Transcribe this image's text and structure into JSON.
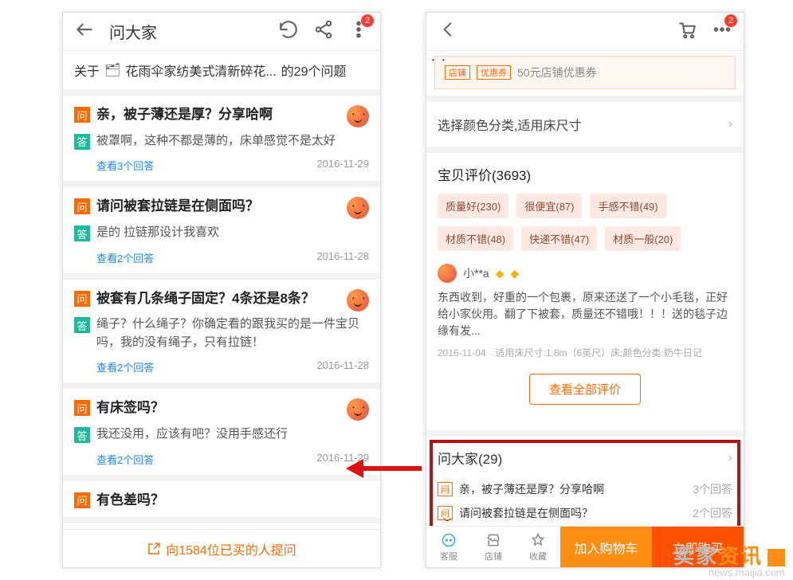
{
  "left": {
    "title": "问大家",
    "about_prefix": "关于",
    "about_product": "花雨伞家纺美式清新碎花...",
    "about_suffix": "的29个问题",
    "items": [
      {
        "q": "亲，被子薄还是厚？分享哈啊",
        "a": "被罩啊，这种不都是薄的，床单感觉不是太好",
        "view": "查看3个回答",
        "date": "2016-11-29"
      },
      {
        "q": "请问被套拉链是在侧面吗？",
        "a": "是的 拉链那设计我喜欢",
        "view": "查看2个回答",
        "date": "2016-11-28"
      },
      {
        "q": "被套有几条绳子固定？4条还是8条？",
        "a": "绳子？什么绳子？你确定看的跟我买的是一件宝贝吗，我的没有绳子，只有拉链！",
        "view": "查看2个回答",
        "date": "2016-11-28"
      },
      {
        "q": "有床签吗？",
        "a": "我还没用，应该有吧？没用手感还行",
        "view": "查看2个回答",
        "date": "2016-11-29"
      },
      {
        "q": "有色差吗？",
        "a": "",
        "view": "",
        "date": ""
      }
    ],
    "tag_q": "问",
    "tag_a": "答",
    "ask_cta": "向1584位已买的人提问"
  },
  "right": {
    "badge": "2",
    "coupon_tag1": "店铺",
    "coupon_tag2": "优惠券",
    "coupon_text": "50元店铺优惠券",
    "sku_row": "选择颜色分类,适用床尺寸",
    "review_title": "宝贝评价(3693)",
    "chips": [
      "质量好(230)",
      "很便宜(87)",
      "手感不错(49)",
      "材质不错(48)",
      "快递不错(47)",
      "材质一般(20)"
    ],
    "reviewer_name": "小**a",
    "review_text": "东西收到，好重的一个包裹，原来还送了一个小毛毯，正好给小家伙用。翻了下被套，质量还不错哦！！！送的毯子边缘有发...",
    "review_meta": "2016-11-04　适用床尺寸:1.8m（6英尺）床;颜色分类:奶牛日记",
    "view_all": "查看全部评价",
    "ask_title": "问大家(29)",
    "mini": [
      {
        "q": "亲，被子薄还是厚？分享哈啊",
        "c": "3个回答"
      },
      {
        "q": "请问被套拉链是在侧面吗？",
        "c": "2个回答"
      }
    ],
    "mini_tag": "问",
    "tabs": {
      "kf": "客服",
      "dp": "店铺",
      "sc": "收藏"
    },
    "btn_cart": "加入购物车",
    "btn_buy": "立即购买"
  },
  "left_badge": "2",
  "watermark": {
    "cn1": "卖家",
    "cn2": "资讯",
    "url": "news.maijia.com"
  }
}
